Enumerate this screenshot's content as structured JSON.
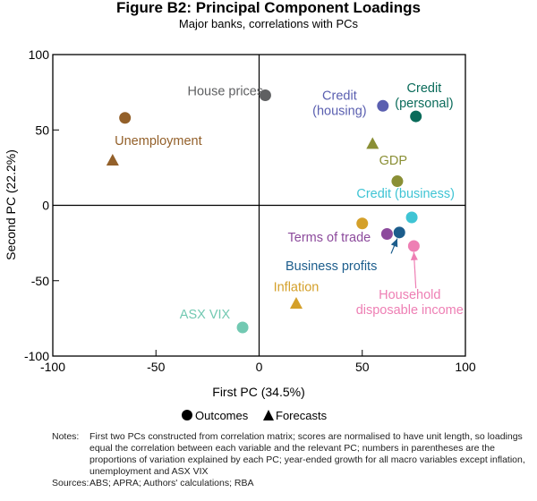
{
  "title": "Figure B2: Principal Component Loadings",
  "subtitle": "Major banks, correlations with PCs",
  "legend": {
    "outcomes": "Outcomes",
    "forecasts": "Forecasts"
  },
  "notes_label": "Notes:",
  "notes_text": "First two PCs constructed from correlation matrix; scores are normalised to have unit length, so loadings equal the correlation between each variable and the relevant PC; numbers in parentheses are the proportions of variation explained by each PC; year-ended growth for all macro variables except inflation, unemployment and ASX VIX",
  "sources_label": "Sources:",
  "sources_text": "ABS; APRA; Authors' calculations; RBA",
  "chart_data": {
    "type": "scatter",
    "title": "Figure B2: Principal Component Loadings",
    "subtitle": "Major banks, correlations with PCs",
    "xlabel": "First PC (34.5%)",
    "ylabel": "Second PC (22.2%)",
    "xlim": [
      -100,
      100
    ],
    "ylim": [
      -100,
      100
    ],
    "xticks": [
      -100,
      -50,
      0,
      50,
      100
    ],
    "yticks": [
      -100,
      -50,
      0,
      50,
      100
    ],
    "grid": false,
    "zero_lines": true,
    "legend_position": "bottom",
    "marker_legend": [
      {
        "marker": "circle",
        "label": "Outcomes"
      },
      {
        "marker": "triangle",
        "label": "Forecasts"
      }
    ],
    "points": [
      {
        "name": "House prices",
        "marker": "circle",
        "x": 3,
        "y": 73,
        "color": "#5f6062"
      },
      {
        "name": "Unemployment",
        "marker": "circle",
        "x": -65,
        "y": 58,
        "color": "#93602a"
      },
      {
        "name": "Unemployment",
        "marker": "triangle",
        "x": -71,
        "y": 30,
        "color": "#93602a"
      },
      {
        "name": "Credit (housing)",
        "marker": "circle",
        "x": 60,
        "y": 66,
        "color": "#5a5fb0"
      },
      {
        "name": "Credit (personal)",
        "marker": "circle",
        "x": 76,
        "y": 59,
        "color": "#0a6b5a"
      },
      {
        "name": "GDP",
        "marker": "triangle",
        "x": 55,
        "y": 41,
        "color": "#8a8f35"
      },
      {
        "name": "GDP",
        "marker": "circle",
        "x": 67,
        "y": 16,
        "color": "#8a8f35"
      },
      {
        "name": "Credit (business)",
        "marker": "circle",
        "x": 74,
        "y": -8,
        "color": "#3fc4d4"
      },
      {
        "name": "Inflation",
        "marker": "circle",
        "x": 50,
        "y": -12,
        "color": "#d4a02a"
      },
      {
        "name": "Terms of trade",
        "marker": "circle",
        "x": 62,
        "y": -19,
        "color": "#8c4a9c"
      },
      {
        "name": "Business profits",
        "marker": "circle",
        "x": 68,
        "y": -18,
        "color": "#1c5d8c"
      },
      {
        "name": "Household disposable income",
        "marker": "circle",
        "x": 75,
        "y": -27,
        "color": "#ee7fb4"
      },
      {
        "name": "Inflation",
        "marker": "triangle",
        "x": 18,
        "y": -65,
        "color": "#d4a02a"
      },
      {
        "name": "ASX VIX",
        "marker": "circle",
        "x": -8,
        "y": -81,
        "color": "#72c9b2"
      }
    ],
    "annotations": [
      {
        "text": [
          "House prices"
        ],
        "x": 2,
        "y": 73,
        "anchor": "end",
        "color": "#5f6062"
      },
      {
        "text": [
          "Unemployment"
        ],
        "x": -70,
        "y": 40,
        "anchor": "start",
        "color": "#93602a"
      },
      {
        "text": [
          "Credit",
          "(housing)"
        ],
        "x": 39,
        "y": 70,
        "anchor": "middle",
        "color": "#5a5fb0"
      },
      {
        "text": [
          "Credit",
          "(personal)"
        ],
        "x": 80,
        "y": 75,
        "anchor": "middle",
        "color": "#0a6b5a"
      },
      {
        "text": [
          "GDP"
        ],
        "x": 65,
        "y": 27,
        "anchor": "middle",
        "color": "#8a8f35"
      },
      {
        "text": [
          "Credit (business)"
        ],
        "x": 71,
        "y": 5,
        "anchor": "middle",
        "color": "#3fc4d4"
      },
      {
        "text": [
          "Terms of trade"
        ],
        "x": 34,
        "y": -24,
        "anchor": "middle",
        "color": "#8c4a9c"
      },
      {
        "text": [
          "Business profits"
        ],
        "x": 35,
        "y": -43,
        "anchor": "middle",
        "color": "#1c5d8c"
      },
      {
        "text": [
          "Inflation"
        ],
        "x": 18,
        "y": -57,
        "anchor": "middle",
        "color": "#d4a02a"
      },
      {
        "text": [
          "Household",
          "disposable income"
        ],
        "x": 73,
        "y": -62,
        "anchor": "middle",
        "color": "#ee7fb4"
      },
      {
        "text": [
          "ASX VIX"
        ],
        "x": -14,
        "y": -75,
        "anchor": "end",
        "color": "#72c9b2"
      }
    ],
    "arrows": [
      {
        "from": [
          64,
          -32
        ],
        "to": [
          67,
          -22
        ],
        "color": "#1c5d8c"
      },
      {
        "from": [
          76,
          -55
        ],
        "to": [
          75,
          -31
        ],
        "color": "#ee7fb4"
      }
    ]
  }
}
